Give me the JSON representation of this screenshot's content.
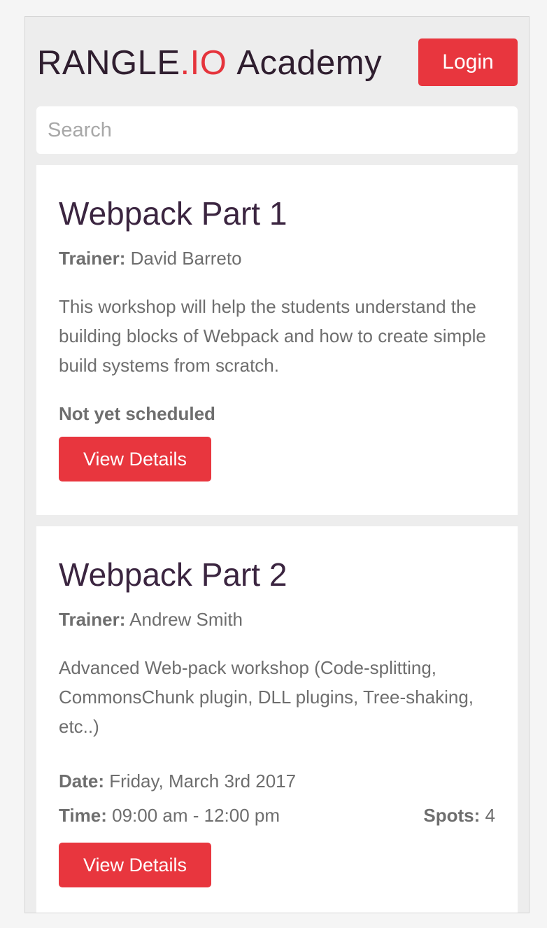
{
  "header": {
    "logo_brand": "RANGLE",
    "logo_dot": ".",
    "logo_io": "IO",
    "logo_academy": "Academy",
    "login_label": "Login"
  },
  "search": {
    "placeholder": "Search"
  },
  "workshops": [
    {
      "title": "Webpack Part 1",
      "trainer_label": "Trainer:",
      "trainer": "David Barreto",
      "description": "This workshop will help the students understand the building blocks of Webpack and how to create simple build systems from scratch.",
      "status": "Not yet scheduled",
      "button_label": "View Details"
    },
    {
      "title": "Webpack Part 2",
      "trainer_label": "Trainer:",
      "trainer": "Andrew Smith",
      "description": "Advanced Web-pack workshop (Code-splitting, CommonsChunk plugin, DLL plugins, Tree-shaking, etc..)",
      "date_label": "Date:",
      "date": "Friday, March 3rd 2017",
      "time_label": "Time:",
      "time": "09:00 am - 12:00 pm",
      "spots_label": "Spots:",
      "spots": "4",
      "button_label": "View Details"
    }
  ],
  "colors": {
    "accent": "#e8363e",
    "title": "#3b2540",
    "background": "#ededed"
  }
}
